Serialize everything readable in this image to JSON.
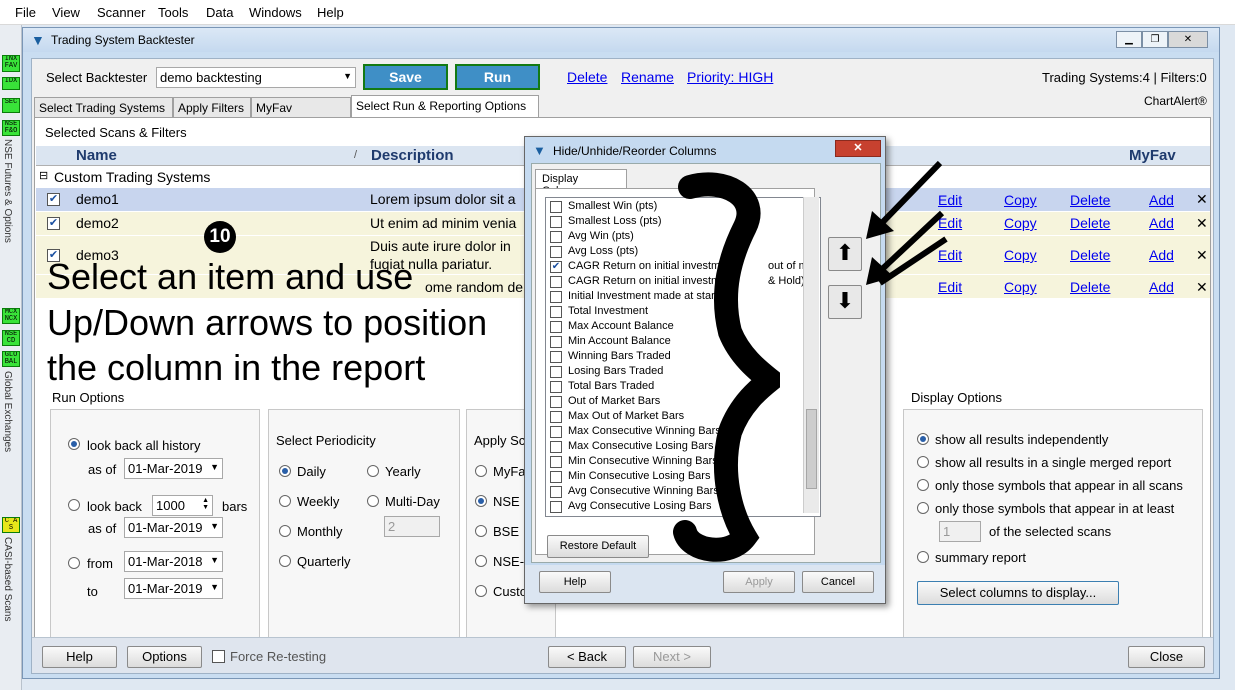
{
  "menu": [
    "File",
    "View",
    "Scanner",
    "Tools",
    "Data",
    "Windows",
    "Help"
  ],
  "left_tags": [
    "INX FAV",
    "IDX",
    "SEC",
    "NSE F&O",
    "MCX NCX",
    "NSE CD",
    "GLO BAL",
    "C A S"
  ],
  "left_labels": [
    "NSE Futures & Options",
    "Global Exchanges",
    "CASI-based Scans"
  ],
  "window": {
    "title": "Trading System Backtester"
  },
  "top": {
    "select_label": "Select Backtester",
    "backtester_value": "demo backtesting",
    "save": "Save",
    "run": "Run",
    "delete": "Delete",
    "rename": "Rename",
    "priority": "Priority: HIGH",
    "status": "Trading Systems:4 | Filters:0",
    "brand": "ChartAlert®"
  },
  "tabs": [
    "Select Trading Systems",
    "Apply Filters",
    "MyFav TS/Filters",
    "Select Run & Reporting Options"
  ],
  "scans_header": "Selected Scans & Filters",
  "grid": {
    "col_name": "Name",
    "col_desc": "Description",
    "col_fav": "MyFav",
    "group": "Custom Trading Systems",
    "rows": [
      {
        "name": "demo1",
        "desc": "Lorem ipsum dolor sit a",
        "edit": "Edit",
        "copy": "Copy",
        "delete": "Delete",
        "add": "Add"
      },
      {
        "name": "demo2",
        "desc": "Ut enim ad minim venia",
        "edit": "Edit",
        "copy": "Copy",
        "delete": "Delete",
        "add": "Add"
      },
      {
        "name": "demo3",
        "desc": "Duis aute irure dolor in",
        "desc2": "fugiat nulla pariatur.",
        "edit": "Edit",
        "copy": "Copy",
        "delete": "Delete",
        "add": "Add"
      },
      {
        "name": "",
        "desc": "ome random de",
        "edit": "Edit",
        "copy": "Copy",
        "delete": "Delete",
        "add": "Add"
      }
    ]
  },
  "step_number": "10",
  "overlay": [
    "Select an item and use",
    "Up/Down arrows to position",
    "the column in the report"
  ],
  "run_options": {
    "title": "Run Options",
    "look_back_all": "look back all history",
    "as_of": "as of",
    "date1": "01-Mar-2019",
    "look_back": "look back",
    "bars_value": "1000",
    "bars": "bars",
    "date2": "01-Mar-2019",
    "from": "from",
    "date3": "01-Mar-2018",
    "to": "to",
    "date4": "01-Mar-2019"
  },
  "periodicity": {
    "title": "Select Periodicity",
    "daily": "Daily",
    "yearly": "Yearly",
    "weekly": "Weekly",
    "multiday": "Multi-Day",
    "multiday_value": "2",
    "monthly": "Monthly",
    "quarterly": "Quarterly"
  },
  "apply_scans": {
    "title": "Apply Sc",
    "opts": [
      "MyFa",
      "NSE",
      "BSE",
      "NSE-",
      "Custo"
    ]
  },
  "display": {
    "title": "Display Options",
    "o1": "show all results independently",
    "o2": "show all results in a single merged report",
    "o3": "only those symbols that appear in all scans",
    "o4": "only those symbols that appear in at least",
    "count": "1",
    "o4b": "of the selected scans",
    "o5": "summary report",
    "select_cols": "Select columns to display..."
  },
  "bottom": {
    "help": "Help",
    "options": "Options",
    "force": "Force Re-testing",
    "back": "< Back",
    "next": "Next >",
    "close": "Close"
  },
  "dialog": {
    "title": "Hide/Unhide/Reorder Columns",
    "tab": "Display Columns",
    "items": [
      {
        "t": "Smallest Win (pts)",
        "c": false
      },
      {
        "t": "Smallest Loss (pts)",
        "c": false
      },
      {
        "t": "Avg Win (pts)",
        "c": false
      },
      {
        "t": "Avg Loss (pts)",
        "c": false
      },
      {
        "t": "CAGR Return on initial investment",
        "t2": "out of mkt",
        "c": true
      },
      {
        "t": "CAGR Return on initial investme",
        "t2": "& Hold)",
        "c": false
      },
      {
        "t": "Initial Investment made at start",
        "c": false
      },
      {
        "t": "Total Investment",
        "c": false
      },
      {
        "t": "Max Account Balance",
        "c": false
      },
      {
        "t": "Min Account Balance",
        "c": false
      },
      {
        "t": "Winning Bars Traded",
        "c": false
      },
      {
        "t": "Losing Bars Traded",
        "c": false
      },
      {
        "t": "Total Bars Traded",
        "c": false
      },
      {
        "t": "Out of Market Bars",
        "c": false
      },
      {
        "t": "Max Out of Market Bars",
        "c": false
      },
      {
        "t": "Max Consecutive Winning Bars",
        "c": false
      },
      {
        "t": "Max Consecutive Losing Bars",
        "c": false
      },
      {
        "t": "Min Consecutive Winning Bars",
        "c": false
      },
      {
        "t": "Min Consecutive Losing Bars",
        "c": false
      },
      {
        "t": "Avg Consecutive Winning Bars",
        "c": false
      },
      {
        "t": "Avg Consecutive Losing Bars",
        "c": false
      }
    ],
    "restore": "Restore Default",
    "help": "Help",
    "apply": "Apply",
    "cancel": "Cancel"
  }
}
